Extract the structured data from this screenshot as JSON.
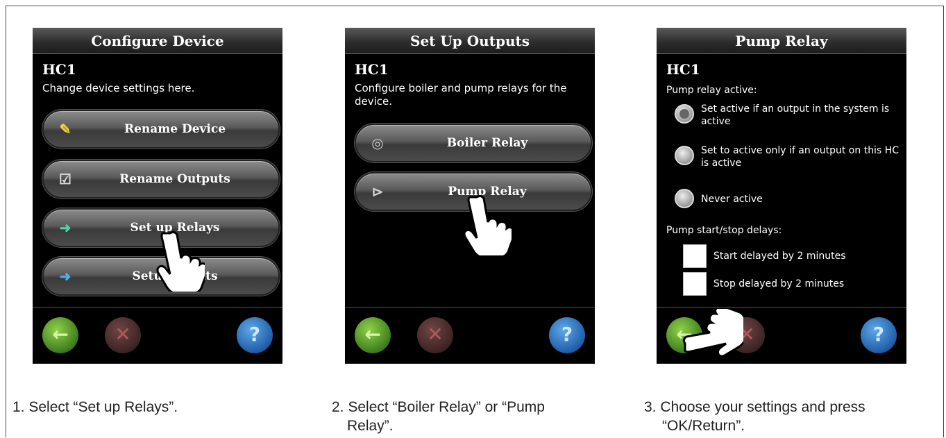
{
  "panel1": {
    "title": "Configure Device",
    "device": "HC1",
    "desc": "Change device settings here.",
    "buttons": [
      {
        "label": "Rename Device",
        "icon": "pencil-icon"
      },
      {
        "label": "Rename Outputs",
        "icon": "checklist-icon"
      },
      {
        "label": "Set up Relays",
        "icon": "relay-arrow-icon"
      },
      {
        "label": "Setup Inputs",
        "icon": "input-arrow-icon"
      }
    ],
    "caption": "1. Select “Set up Relays”."
  },
  "panel2": {
    "title": "Set Up Outputs",
    "device": "HC1",
    "desc": "Configure boiler and pump relays for the device.",
    "buttons": [
      {
        "label": "Boiler Relay",
        "icon": "boiler-icon"
      },
      {
        "label": "Pump Relay",
        "icon": "pump-icon"
      }
    ],
    "caption_line1": "2. Select “Boiler Relay” or “Pump",
    "caption_line2": "Relay”."
  },
  "panel3": {
    "title": "Pump Relay",
    "device": "HC1",
    "relay_label": "Pump relay active:",
    "options": [
      {
        "text": "Set active if an output in the system is active",
        "selected": true
      },
      {
        "text": "Set to active only if an output on this HC is active",
        "selected": false
      },
      {
        "text": "Never active",
        "selected": false
      }
    ],
    "delay_label": "Pump start/stop delays:",
    "checks": [
      {
        "text": "Start delayed by 2 minutes",
        "checked": false
      },
      {
        "text": "Stop delayed by 2 minutes",
        "checked": false
      }
    ],
    "caption_line1": "3.  Choose your settings and press",
    "caption_line2": "“OK/Return”."
  },
  "footer": {
    "back": "←",
    "cancel": "✕",
    "help": "?"
  },
  "colors": {
    "screen": "#000000",
    "back_button": "#5aa62f",
    "cancel_button": "#5a2f2f",
    "help_button": "#2f78c8"
  }
}
